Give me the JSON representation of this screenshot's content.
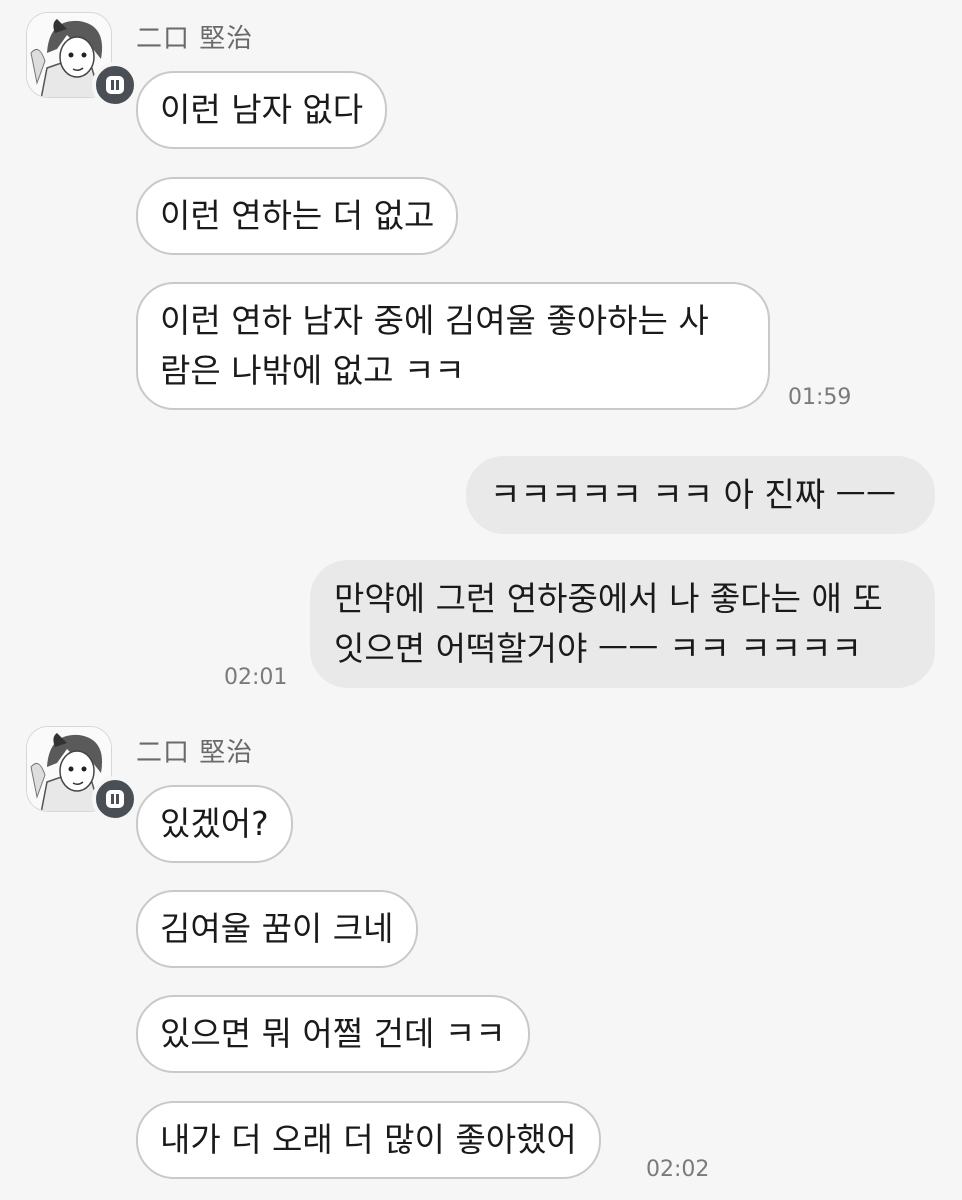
{
  "conversation": {
    "group1": {
      "sender": "二口 堅治",
      "messages": [
        "이런 남자 없다",
        "이런 연하는 더 없고",
        "이런 연하 남자 중에 김여울 좋아하는 사",
        "람은 나밖에 없고 ㅋㅋ"
      ],
      "time": "01:59"
    },
    "outgoing": {
      "messages": [
        "ㅋㅋㅋㅋㅋ ㅋㅋ 아 진짜 ㅡㅡ",
        "만약에 그런 연하중에서 나 좋다는 애 또",
        "잇으면 어떡할거야 ㅡㅡ ㅋㅋ ㅋㅋㅋㅋ"
      ],
      "time": "02:01"
    },
    "group2": {
      "sender": "二口 堅治",
      "messages": [
        "있겠어?",
        "김여울 꿈이 크네",
        "있으면 뭐 어쩔 건데 ㅋㅋ",
        "내가 더 오래 더 많이 좋아했어"
      ],
      "time": "02:02"
    }
  },
  "icons": {
    "avatar": "profile-avatar-icon",
    "badge": "chat-channel-badge-icon"
  },
  "colors": {
    "incoming_bubble": "#ffffff",
    "incoming_border": "#c9c9c9",
    "outgoing_bubble": "#e9e9e9",
    "badge": "#4a4f56"
  }
}
